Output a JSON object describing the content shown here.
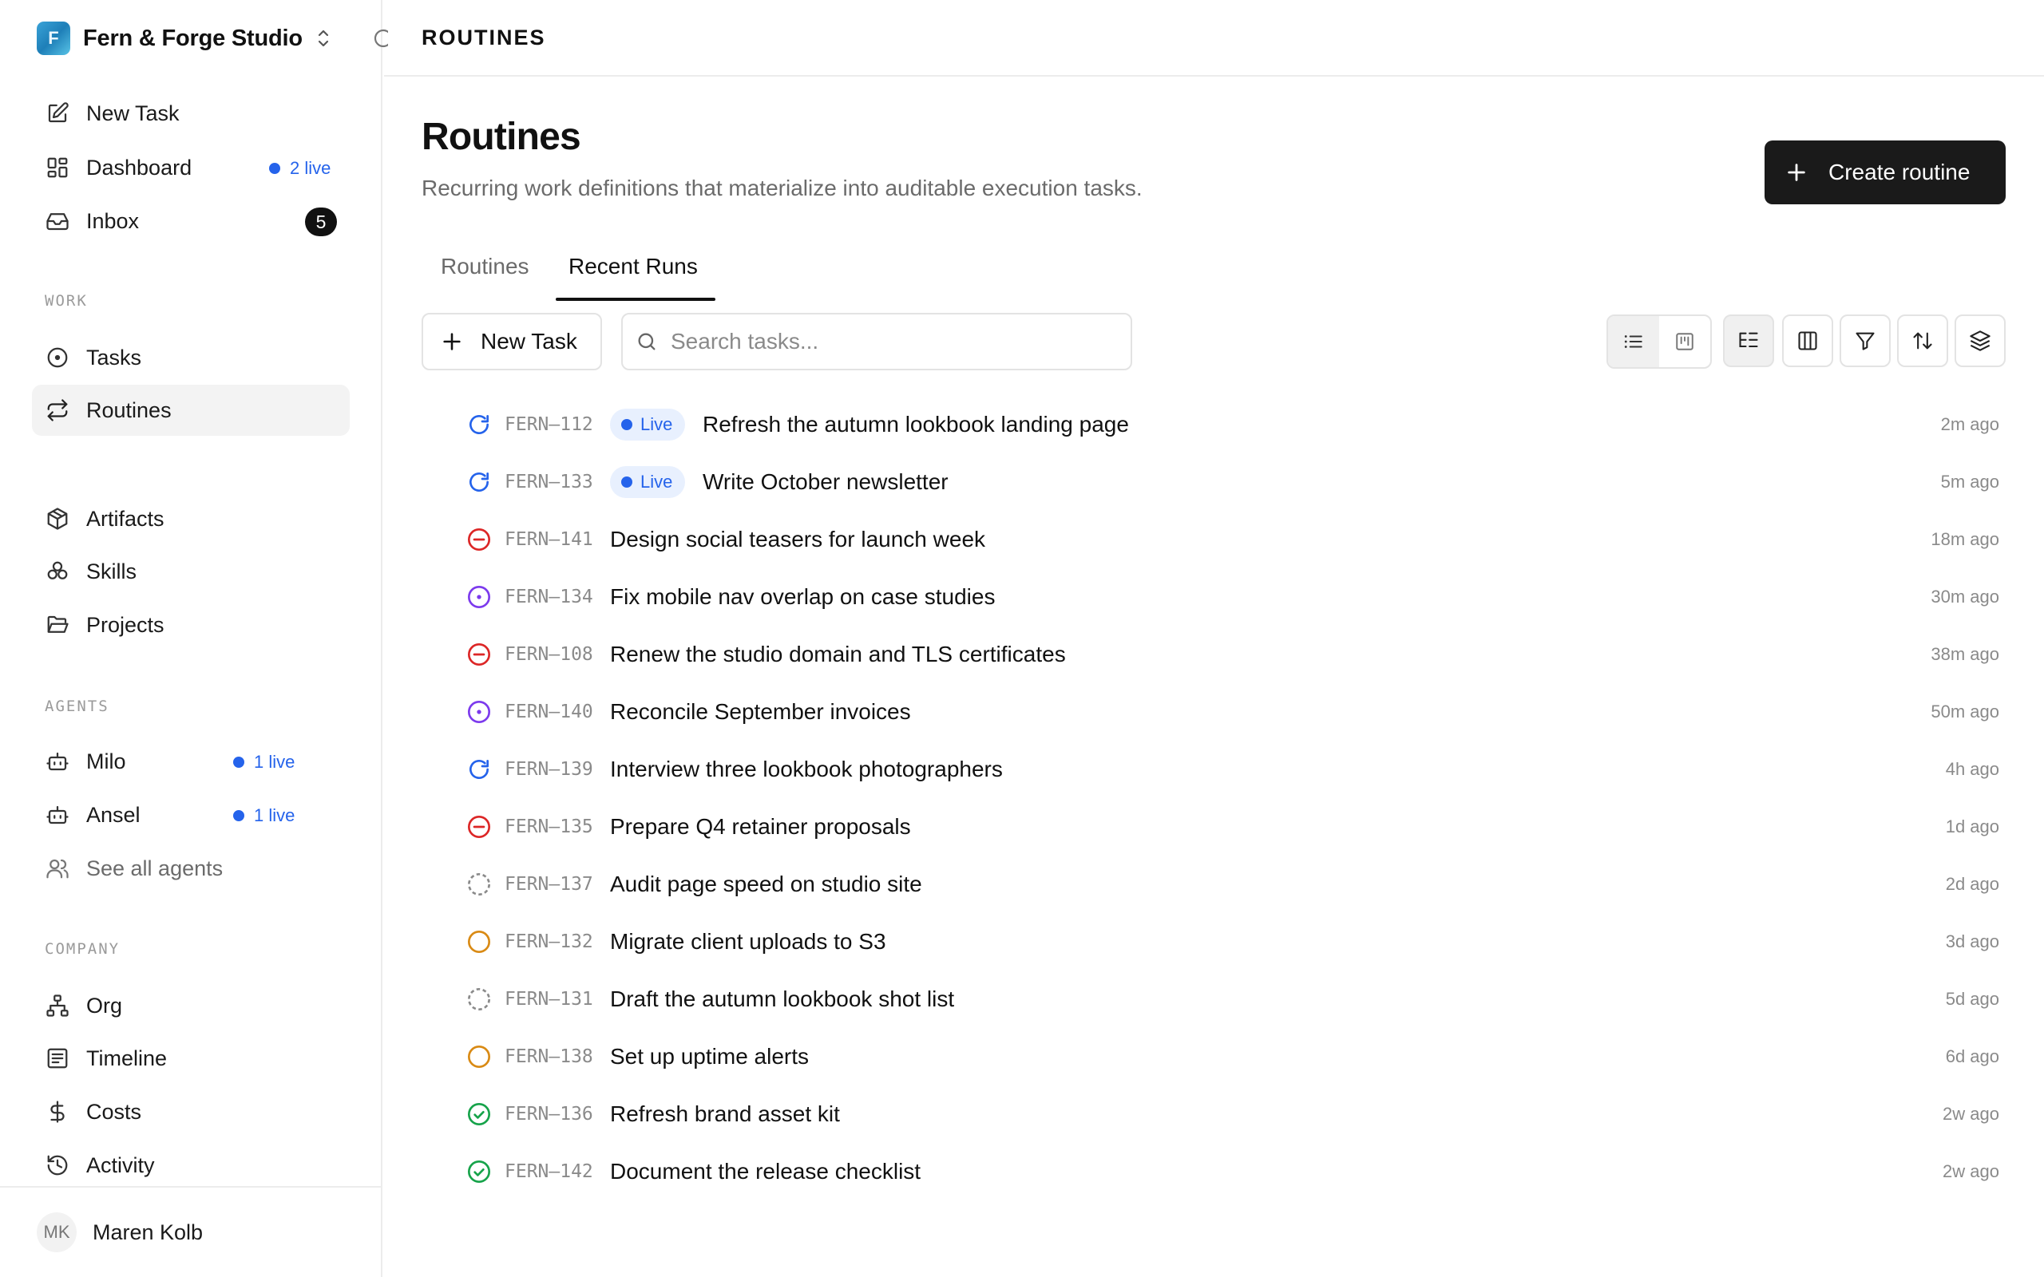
{
  "workspace": {
    "name": "Fern & Forge Studio",
    "logo_letter": "F"
  },
  "nav": {
    "new_task": "New Task",
    "dashboard": {
      "label": "Dashboard",
      "live": "2 live"
    },
    "inbox": {
      "label": "Inbox",
      "count": "5"
    },
    "work_label": "WORK",
    "tasks": "Tasks",
    "routines": "Routines",
    "artifacts": "Artifacts",
    "skills": "Skills",
    "projects": "Projects",
    "agents_label": "AGENTS",
    "agents": [
      {
        "name": "Milo",
        "live": "1 live"
      },
      {
        "name": "Ansel",
        "live": "1 live"
      }
    ],
    "see_all_agents": "See all agents",
    "company_label": "COMPANY",
    "org": "Org",
    "timeline": "Timeline",
    "costs": "Costs",
    "activity": "Activity"
  },
  "user": {
    "initials": "MK",
    "name": "Maren Kolb"
  },
  "topbar": {
    "title": "ROUTINES"
  },
  "page": {
    "title": "Routines",
    "subtitle": "Recurring work definitions that materialize into auditable execution tasks.",
    "create_button": "Create routine"
  },
  "tabs": [
    {
      "label": "Routines",
      "active": false
    },
    {
      "label": "Recent Runs",
      "active": true
    }
  ],
  "toolbar": {
    "new_task": "New Task",
    "search_placeholder": "Search tasks...",
    "view_active": "list"
  },
  "colors": {
    "accent_blue": "#2563eb",
    "status_running": "#2563eb",
    "status_blocked": "#dc2626",
    "status_review": "#7c3aed",
    "status_todo": "#d98a14",
    "status_done": "#16a34a",
    "status_backlog": "#8a8a8a"
  },
  "tasks": [
    {
      "id": "FERN–112",
      "status": "running",
      "live": "Live",
      "title": "Refresh the autumn lookbook landing page",
      "time": "2m ago"
    },
    {
      "id": "FERN–133",
      "status": "running",
      "live": "Live",
      "title": "Write October newsletter",
      "time": "5m ago"
    },
    {
      "id": "FERN–141",
      "status": "blocked",
      "title": "Design social teasers for launch week",
      "time": "18m ago"
    },
    {
      "id": "FERN–134",
      "status": "review",
      "title": "Fix mobile nav overlap on case studies",
      "time": "30m ago"
    },
    {
      "id": "FERN–108",
      "status": "blocked",
      "title": "Renew the studio domain and TLS certificates",
      "time": "38m ago"
    },
    {
      "id": "FERN–140",
      "status": "review",
      "title": "Reconcile September invoices",
      "time": "50m ago"
    },
    {
      "id": "FERN–139",
      "status": "running",
      "title": "Interview three lookbook photographers",
      "time": "4h ago"
    },
    {
      "id": "FERN–135",
      "status": "blocked",
      "title": "Prepare Q4 retainer proposals",
      "time": "1d ago"
    },
    {
      "id": "FERN–137",
      "status": "backlog",
      "title": "Audit page speed on studio site",
      "time": "2d ago"
    },
    {
      "id": "FERN–132",
      "status": "todo",
      "title": "Migrate client uploads to S3",
      "time": "3d ago"
    },
    {
      "id": "FERN–131",
      "status": "backlog",
      "title": "Draft the autumn lookbook shot list",
      "time": "5d ago"
    },
    {
      "id": "FERN–138",
      "status": "todo",
      "title": "Set up uptime alerts",
      "time": "6d ago"
    },
    {
      "id": "FERN–136",
      "status": "done",
      "title": "Refresh brand asset kit",
      "time": "2w ago"
    },
    {
      "id": "FERN–142",
      "status": "done",
      "title": "Document the release checklist",
      "time": "2w ago"
    }
  ]
}
